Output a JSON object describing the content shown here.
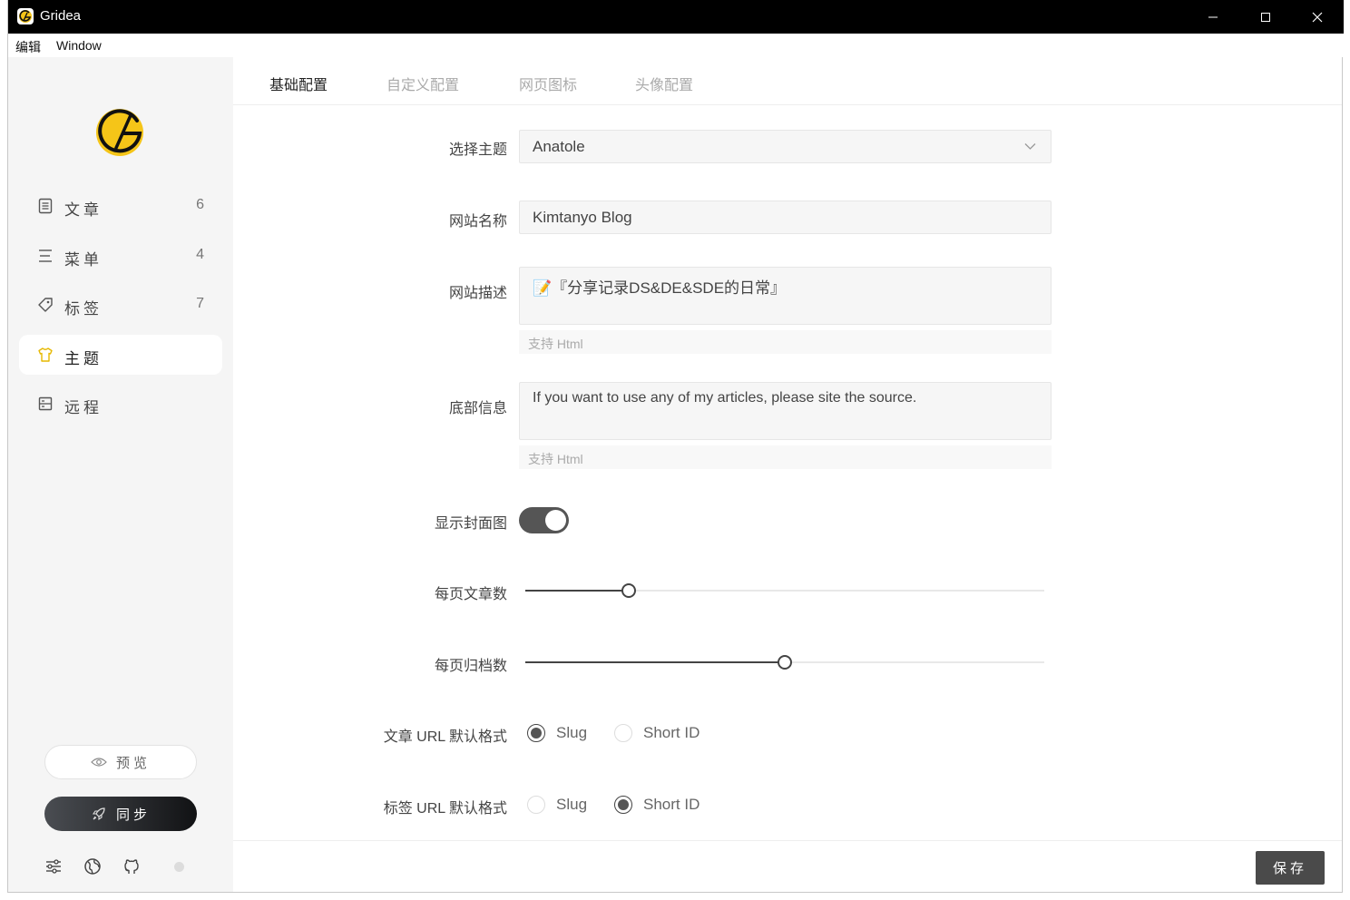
{
  "window": {
    "title": "Gridea"
  },
  "menu": {
    "items": [
      "编辑",
      "Window"
    ]
  },
  "sidebar": {
    "items": [
      {
        "label": "文章",
        "count": "6",
        "icon": "document-icon"
      },
      {
        "label": "菜单",
        "count": "4",
        "icon": "menu-lines-icon"
      },
      {
        "label": "标签",
        "count": "7",
        "icon": "tag-icon"
      },
      {
        "label": "主题",
        "count": "",
        "icon": "shirt-icon",
        "active": true
      },
      {
        "label": "远程",
        "count": "",
        "icon": "server-icon"
      }
    ],
    "preview_label": "预览",
    "sync_label": "同步"
  },
  "tabs": [
    {
      "label": "基础配置",
      "active": true
    },
    {
      "label": "自定义配置"
    },
    {
      "label": "网页图标"
    },
    {
      "label": "头像配置"
    }
  ],
  "form": {
    "theme": {
      "label": "选择主题",
      "value": "Anatole"
    },
    "site_name": {
      "label": "网站名称",
      "value": "Kimtanyo Blog"
    },
    "site_desc": {
      "label": "网站描述",
      "value": "📝『分享记录DS&DE&SDE的日常』",
      "hint": "支持 Html"
    },
    "footer_info": {
      "label": "底部信息",
      "value": "If you want to use any of my articles, please site the source.",
      "hint": "支持 Html"
    },
    "show_cover": {
      "label": "显示封面图",
      "value": true
    },
    "posts_per_page": {
      "label": "每页文章数",
      "fraction": 0.2
    },
    "archives_per_page": {
      "label": "每页归档数",
      "fraction": 0.5
    },
    "post_url_format": {
      "label": "文章 URL 默认格式",
      "options": [
        "Slug",
        "Short ID"
      ],
      "selected": "Slug"
    },
    "tag_url_format": {
      "label": "标签 URL 默认格式",
      "options": [
        "Slug",
        "Short ID"
      ],
      "selected": "Short ID"
    }
  },
  "footer": {
    "save_label": "保存"
  },
  "colors": {
    "accent": "#4a4a4a",
    "logo_yellow": "#f5c518",
    "sidebar_bg": "#f5f5f5"
  }
}
